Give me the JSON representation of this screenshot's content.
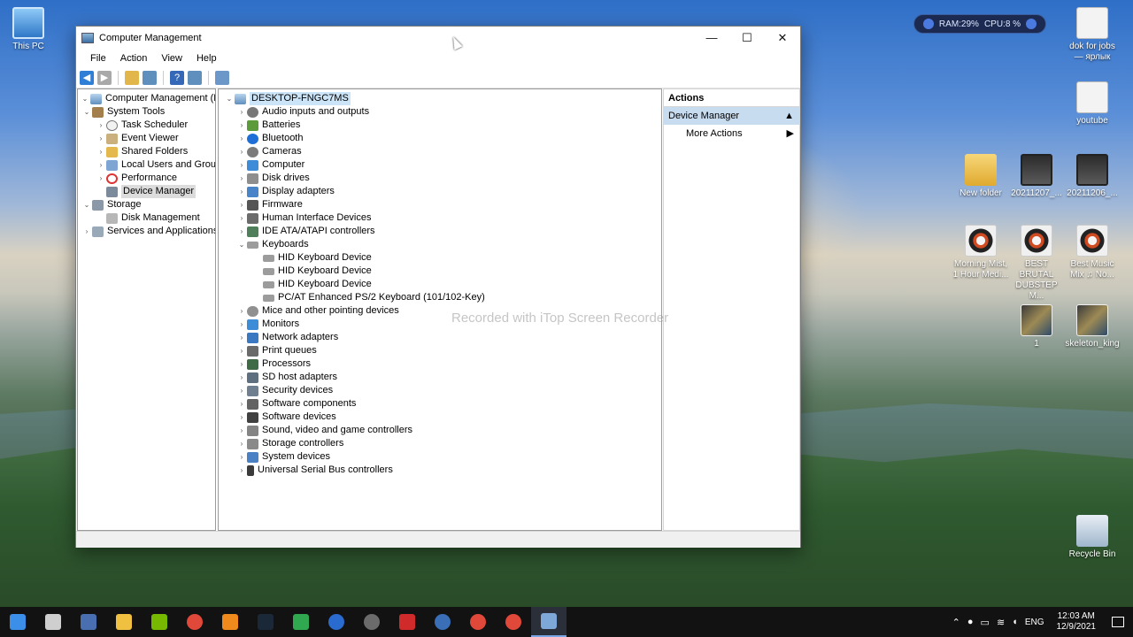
{
  "window": {
    "title": "Computer Management",
    "menu": [
      "File",
      "Action",
      "View",
      "Help"
    ],
    "controls": {
      "minimize": "—",
      "maximize": "☐",
      "close": "✕"
    }
  },
  "left_tree": [
    {
      "label": "Computer Management (Local)",
      "indent": 0,
      "expander": "⌄",
      "icon": "pc-icon",
      "selected": false
    },
    {
      "label": "System Tools",
      "indent": 1,
      "expander": "⌄",
      "icon": "tools-icon",
      "selected": false
    },
    {
      "label": "Task Scheduler",
      "indent": 2,
      "expander": "›",
      "icon": "clock-icon",
      "selected": false
    },
    {
      "label": "Event Viewer",
      "indent": 2,
      "expander": "›",
      "icon": "event-viewer-icon",
      "selected": false
    },
    {
      "label": "Shared Folders",
      "indent": 2,
      "expander": "›",
      "icon": "folder-icon",
      "selected": false
    },
    {
      "label": "Local Users and Groups",
      "indent": 2,
      "expander": "›",
      "icon": "users-icon",
      "selected": false
    },
    {
      "label": "Performance",
      "indent": 2,
      "expander": "›",
      "icon": "performance-icon",
      "selected": false
    },
    {
      "label": "Device Manager",
      "indent": 2,
      "expander": "",
      "icon": "device-manager-icon",
      "selected": true
    },
    {
      "label": "Storage",
      "indent": 1,
      "expander": "⌄",
      "icon": "storage-icon",
      "selected": false
    },
    {
      "label": "Disk Management",
      "indent": 2,
      "expander": "",
      "icon": "disk-icon",
      "selected": false
    },
    {
      "label": "Services and Applications",
      "indent": 1,
      "expander": "›",
      "icon": "services-icon",
      "selected": false
    }
  ],
  "device_tree": {
    "root": "DESKTOP-FNGC7MS",
    "items": [
      {
        "label": "Audio inputs and outputs",
        "icon": "audio-icon",
        "expanded": false,
        "child": false
      },
      {
        "label": "Batteries",
        "icon": "battery-icon",
        "expanded": false,
        "child": false
      },
      {
        "label": "Bluetooth",
        "icon": "bluetooth-icon",
        "expanded": false,
        "child": false
      },
      {
        "label": "Cameras",
        "icon": "camera-icon",
        "expanded": false,
        "child": false
      },
      {
        "label": "Computer",
        "icon": "computer-icon",
        "expanded": false,
        "child": false
      },
      {
        "label": "Disk drives",
        "icon": "disk-drive-icon",
        "expanded": false,
        "child": false
      },
      {
        "label": "Display adapters",
        "icon": "display-adapter-icon",
        "expanded": false,
        "child": false
      },
      {
        "label": "Firmware",
        "icon": "firmware-icon",
        "expanded": false,
        "child": false
      },
      {
        "label": "Human Interface Devices",
        "icon": "hid-icon",
        "expanded": false,
        "child": false
      },
      {
        "label": "IDE ATA/ATAPI controllers",
        "icon": "ide-icon",
        "expanded": false,
        "child": false
      },
      {
        "label": "Keyboards",
        "icon": "keyboard-icon",
        "expanded": true,
        "child": false
      },
      {
        "label": "HID Keyboard Device",
        "icon": "keyboard-icon",
        "expanded": false,
        "child": true
      },
      {
        "label": "HID Keyboard Device",
        "icon": "keyboard-icon",
        "expanded": false,
        "child": true
      },
      {
        "label": "HID Keyboard Device",
        "icon": "keyboard-icon",
        "expanded": false,
        "child": true
      },
      {
        "label": "PC/AT Enhanced PS/2 Keyboard (101/102-Key)",
        "icon": "keyboard-icon",
        "expanded": false,
        "child": true
      },
      {
        "label": "Mice and other pointing devices",
        "icon": "mouse-icon",
        "expanded": false,
        "child": false
      },
      {
        "label": "Monitors",
        "icon": "monitor-icon",
        "expanded": false,
        "child": false
      },
      {
        "label": "Network adapters",
        "icon": "network-icon",
        "expanded": false,
        "child": false
      },
      {
        "label": "Print queues",
        "icon": "printer-icon",
        "expanded": false,
        "child": false
      },
      {
        "label": "Processors",
        "icon": "processor-icon",
        "expanded": false,
        "child": false
      },
      {
        "label": "SD host adapters",
        "icon": "sd-icon",
        "expanded": false,
        "child": false
      },
      {
        "label": "Security devices",
        "icon": "security-icon",
        "expanded": false,
        "child": false
      },
      {
        "label": "Software components",
        "icon": "software-component-icon",
        "expanded": false,
        "child": false
      },
      {
        "label": "Software devices",
        "icon": "software-device-icon",
        "expanded": false,
        "child": false
      },
      {
        "label": "Sound, video and game controllers",
        "icon": "sound-icon",
        "expanded": false,
        "child": false
      },
      {
        "label": "Storage controllers",
        "icon": "storage-controller-icon",
        "expanded": false,
        "child": false
      },
      {
        "label": "System devices",
        "icon": "system-devices-icon",
        "expanded": false,
        "child": false
      },
      {
        "label": "Universal Serial Bus controllers",
        "icon": "usb-icon",
        "expanded": false,
        "child": false
      }
    ]
  },
  "actions": {
    "header": "Actions",
    "section": "Device Manager",
    "section_arrow": "▲",
    "item": "More Actions",
    "item_arrow": "▶"
  },
  "watermark": "Recorded with iTop Screen Recorder",
  "system_widget": {
    "ram": "RAM:29%",
    "cpu": "CPU:8 %"
  },
  "desktop_icons": [
    {
      "label": "This PC",
      "icon": "this-pc-icon"
    },
    {
      "label": "dok for jobs — ярлык",
      "icon": "document-shortcut-icon"
    },
    {
      "label": "youtube",
      "icon": "document-shortcut-icon"
    },
    {
      "label": "New folder",
      "icon": "folder-icon"
    },
    {
      "label": "20211207_...",
      "icon": "video-icon"
    },
    {
      "label": "20211206_...",
      "icon": "video-icon"
    },
    {
      "label": "Morning Mist, 1 Hour Medi...",
      "icon": "audio-file-icon"
    },
    {
      "label": "BEST BRUTAL DUBSTEP M...",
      "icon": "audio-file-icon"
    },
    {
      "label": "Best Music Mix ♫ No...",
      "icon": "audio-file-icon"
    },
    {
      "label": "1",
      "icon": "image-icon"
    },
    {
      "label": "skeleton_king",
      "icon": "image-icon"
    },
    {
      "label": "Recycle Bin",
      "icon": "recycle-bin-icon"
    }
  ],
  "taskbar": {
    "apps": [
      "start-icon",
      "search-icon",
      "calculator-icon",
      "file-explorer-icon",
      "nvidia-icon",
      "chrome-icon",
      "vlc-icon",
      "steam-icon",
      "xbox-icon",
      "ccleaner-icon",
      "obs-icon",
      "recorder-icon",
      "globe-icon",
      "chrome-icon",
      "chrome-icon",
      "computer-management-icon"
    ],
    "tray": {
      "language": "ENG",
      "time": "12:03 AM",
      "date": "12/9/2021"
    }
  }
}
